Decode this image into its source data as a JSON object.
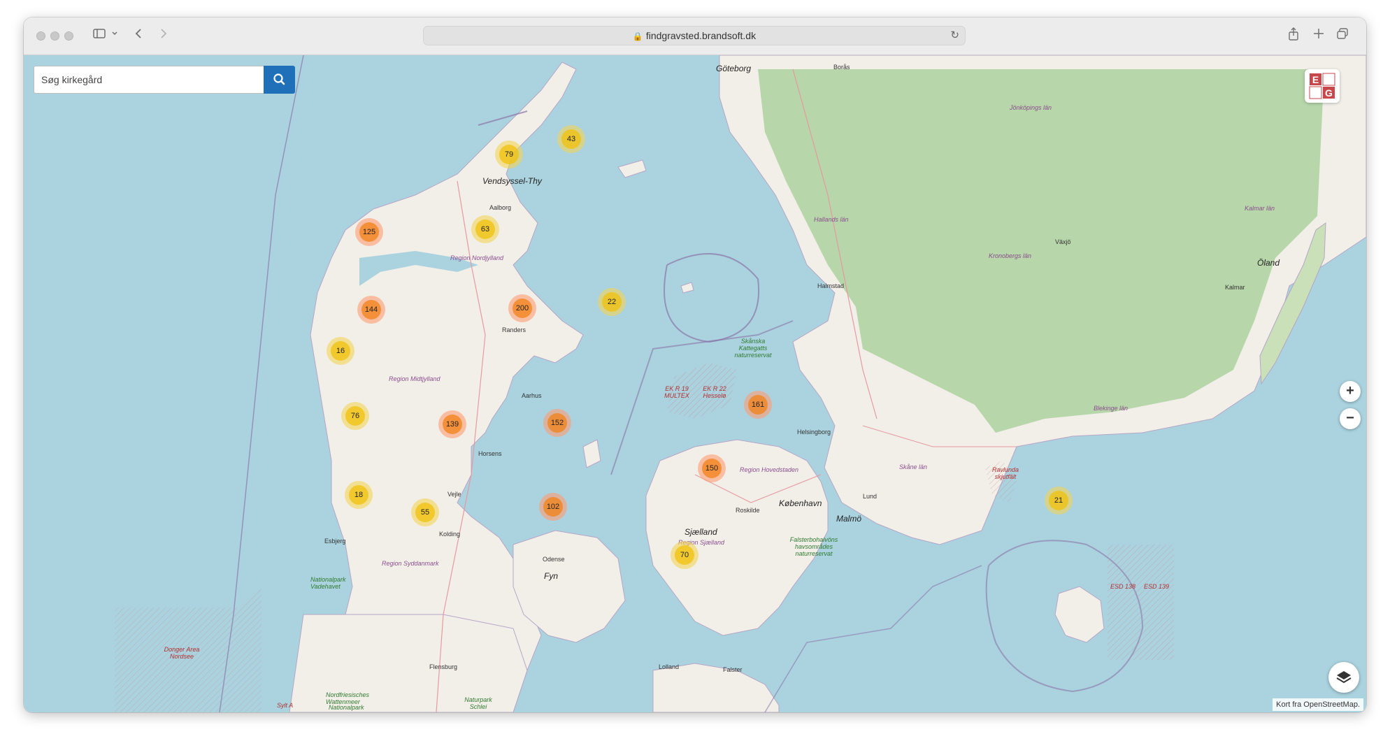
{
  "browser": {
    "url": "findgravsted.brandsoft.dk"
  },
  "search": {
    "placeholder": "Søg kirkegård"
  },
  "logo": {
    "letters": [
      "E",
      "G"
    ],
    "accent_color": "#c8474b"
  },
  "zoom": {
    "in_label": "+",
    "out_label": "−"
  },
  "attribution": {
    "prefix": "Kort fra",
    "link_text": "OpenStreetMap",
    "suffix": "."
  },
  "clusters": [
    {
      "count": "43",
      "level": "medium"
    },
    {
      "count": "79",
      "level": "medium"
    },
    {
      "count": "125",
      "level": "large"
    },
    {
      "count": "63",
      "level": "medium"
    },
    {
      "count": "144",
      "level": "large"
    },
    {
      "count": "200",
      "level": "large"
    },
    {
      "count": "22",
      "level": "medium"
    },
    {
      "count": "16",
      "level": "medium"
    },
    {
      "count": "76",
      "level": "medium"
    },
    {
      "count": "139",
      "level": "large"
    },
    {
      "count": "152",
      "level": "large"
    },
    {
      "count": "161",
      "level": "large"
    },
    {
      "count": "150",
      "level": "large"
    },
    {
      "count": "18",
      "level": "medium"
    },
    {
      "count": "55",
      "level": "medium"
    },
    {
      "count": "102",
      "level": "large"
    },
    {
      "count": "70",
      "level": "medium"
    },
    {
      "count": "21",
      "level": "medium"
    }
  ],
  "place_labels": [
    "Göteborg",
    "Borås",
    "Jönköpings län",
    "Hallands län",
    "Halmstad",
    "Växjö",
    "Kronobergs län",
    "Kalmar län",
    "Kalmar",
    "Öland",
    "Vendsyssel-Thy",
    "Aalborg",
    "Region Nordjylland",
    "Randers",
    "Region Midtjylland",
    "Aarhus",
    "Horsens",
    "Vejle",
    "Kolding",
    "Esbjerg",
    "Region Syddanmark",
    "Odense",
    "Fyn",
    "Sjælland",
    "Region Sjælland",
    "Roskilde",
    "København",
    "Region Hovedstaden",
    "Helsingborg",
    "Skåne län",
    "Lund",
    "Malmö",
    "Blekinge län",
    "Flensburg",
    "Falster",
    "Lolland",
    "Donger Area Nordsee",
    "Nationalpark Vadehavet",
    "Skånska Kattegatts naturreservat",
    "EK R 19 MULTEX",
    "EK R 22 Hesselø",
    "Falsterbohalvöns havsområdes naturreservat",
    "Ravlunda skjutfält",
    "ESD 138",
    "ESD 139",
    "Naturpark Schlei",
    "Sylt A",
    "Nordfriesisches Wattenmeer",
    "Nationalpark"
  ],
  "colors": {
    "water": "#aad3df",
    "land": "#f2efe9",
    "forest": "#add19e",
    "cluster_medium": "#f0c20c",
    "cluster_large": "#f18017"
  }
}
